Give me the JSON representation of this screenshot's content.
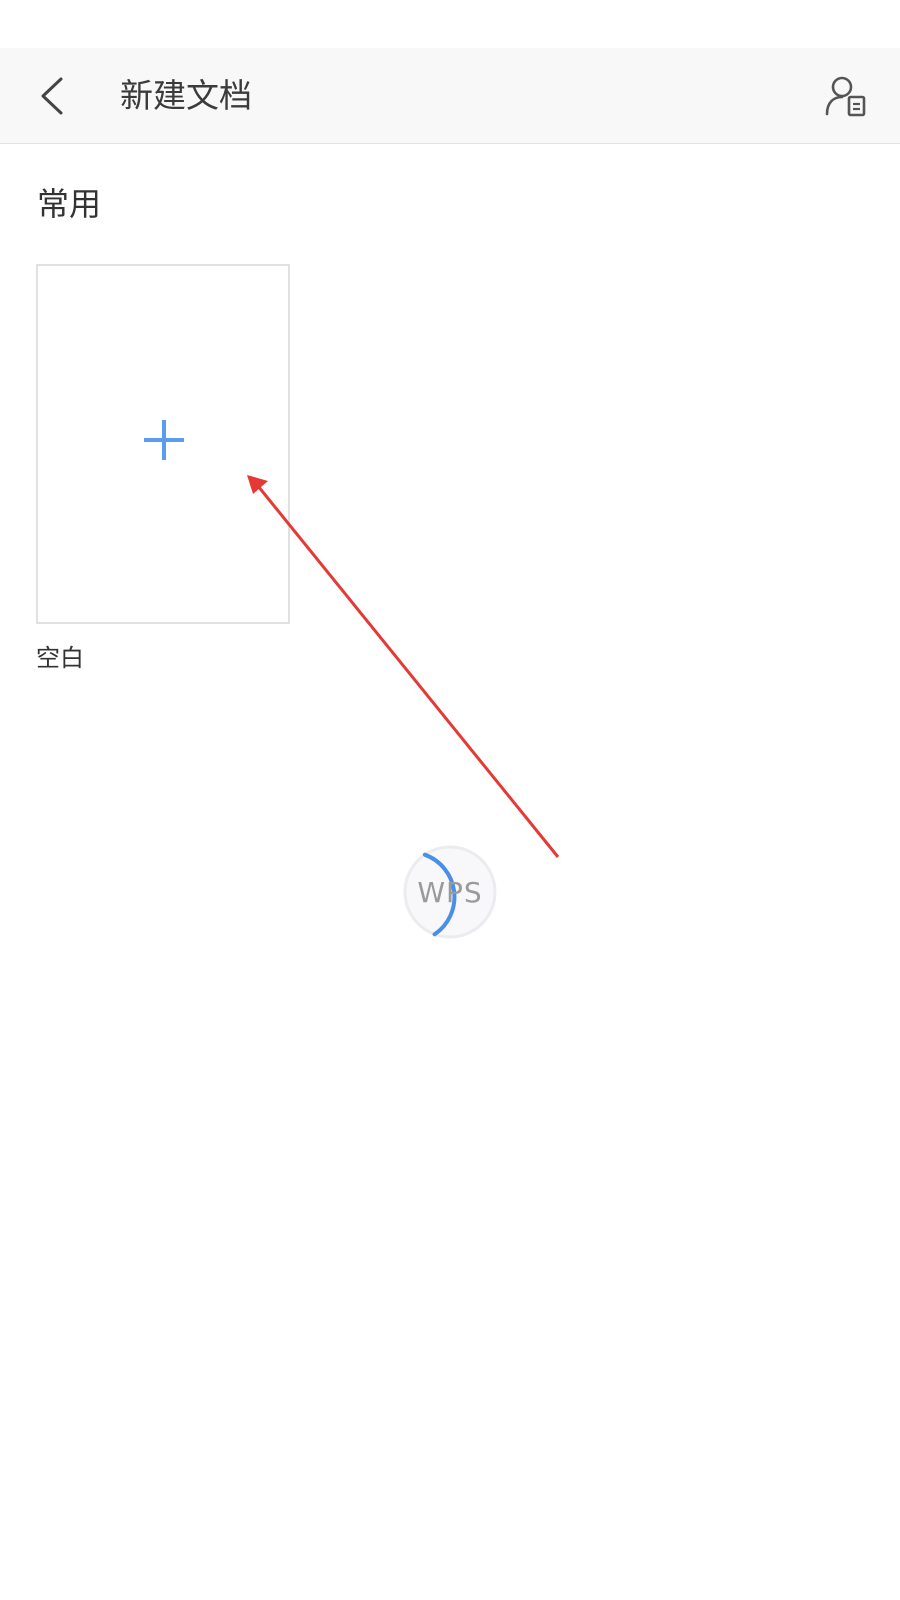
{
  "header": {
    "title": "新建文档",
    "back_icon": "chevron-left-icon",
    "account_icon": "user-document-icon"
  },
  "section": {
    "title": "常用"
  },
  "templates": [
    {
      "label": "空白",
      "icon": "plus-icon"
    }
  ],
  "loading": {
    "logo_text": "WPS",
    "progress": 0.35
  },
  "colors": {
    "accent_blue": "#4a8fe7",
    "plus_blue": "#5b9cf0",
    "annotation_red": "#e53935",
    "toolbar_bg": "#f8f8f8"
  }
}
